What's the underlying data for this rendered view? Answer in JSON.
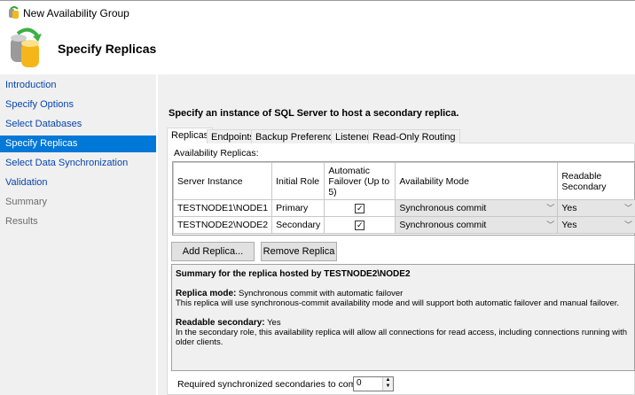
{
  "window": {
    "title": "New Availability Group"
  },
  "header": {
    "title": "Specify Replicas"
  },
  "sidebar": {
    "items": [
      {
        "label": "Introduction",
        "state": "link"
      },
      {
        "label": "Specify Options",
        "state": "link"
      },
      {
        "label": "Select Databases",
        "state": "link"
      },
      {
        "label": "Specify Replicas",
        "state": "selected"
      },
      {
        "label": "Select Data Synchronization",
        "state": "link"
      },
      {
        "label": "Validation",
        "state": "link"
      },
      {
        "label": "Summary",
        "state": "disabled"
      },
      {
        "label": "Results",
        "state": "disabled"
      }
    ]
  },
  "main": {
    "instruction": "Specify an instance of SQL Server to host a secondary replica.",
    "tabs": [
      "Replicas",
      "Endpoints",
      "Backup Preferences",
      "Listener",
      "Read-Only Routing"
    ],
    "grid_label": "Availability Replicas:",
    "columns": [
      "Server Instance",
      "Initial Role",
      "Automatic Failover (Up to 5)",
      "Availability Mode",
      "Readable Secondary"
    ],
    "rows": [
      {
        "server": "TESTNODE1\\NODE1",
        "role": "Primary",
        "failover": true,
        "mode": "Synchronous commit",
        "readable": "Yes"
      },
      {
        "server": "TESTNODE2\\NODE2",
        "role": "Secondary",
        "failover": true,
        "mode": "Synchronous commit",
        "readable": "Yes"
      }
    ],
    "add_button": "Add Replica...",
    "remove_button": "Remove Replica",
    "summary": {
      "title": "Summary for the replica hosted by TESTNODE2\\NODE2",
      "mode_label": "Replica mode:",
      "mode_value": "Synchronous commit with automatic failover",
      "mode_desc": "This replica will use synchronous-commit availability mode and will support both automatic failover and manual failover.",
      "readable_label": "Readable secondary:",
      "readable_value": "Yes",
      "readable_desc": "In the secondary role, this availability replica will allow all connections for read access, including connections running with older clients."
    },
    "required_label": "Required synchronized secondaries to commit",
    "required_value": "0"
  },
  "colors": {
    "accent": "#0078d7",
    "link": "#0645ad"
  }
}
